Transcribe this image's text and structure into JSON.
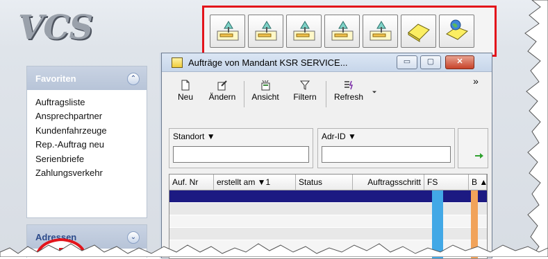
{
  "logo": {
    "text": "VCS"
  },
  "toolbar": {
    "buttons": [
      {
        "name": "auftrag-icon-1"
      },
      {
        "name": "auftrag-icon-2"
      },
      {
        "name": "auftrag-icon-3"
      },
      {
        "name": "auftrag-icon-4"
      },
      {
        "name": "auftrag-icon-5"
      },
      {
        "name": "eraser-icon"
      },
      {
        "name": "globe-eraser-icon"
      }
    ]
  },
  "sidebar": {
    "favorites": {
      "title": "Favoriten",
      "collapse_glyph": "⌃",
      "items": [
        "Auftragsliste",
        "Ansprechpartner",
        "Kundenfahrzeuge",
        "Rep.-Auftrag neu",
        "Serienbriefe",
        "Zahlungsverkehr"
      ]
    },
    "addresses": {
      "title": "Adressen",
      "expand_glyph": "⌄"
    }
  },
  "window": {
    "title": "Aufträge von Mandant  KSR SERVICE...",
    "buttons": {
      "minimize": "▭",
      "maximize": "▢",
      "close": "✕"
    },
    "commands": {
      "neu": "Neu",
      "aendern": "Ändern",
      "ansicht": "Ansicht",
      "filtern": "Filtern",
      "refresh": "Refresh",
      "more": "»"
    },
    "filters": {
      "standort_label": "Standort ▼",
      "standort_value": "",
      "adr_id_label": "Adr-ID ▼",
      "adr_id_value": ""
    },
    "grid": {
      "columns": [
        "Auf. Nr",
        "erstellt am ▼1",
        "Status",
        "Auftragsschritt",
        "FS",
        "B ▲"
      ]
    }
  },
  "colors": {
    "highlight_border": "#e3141b",
    "selected_row": "#1c1a82",
    "fs_column": "#42a8e6",
    "b_column": "#f1a35a"
  }
}
